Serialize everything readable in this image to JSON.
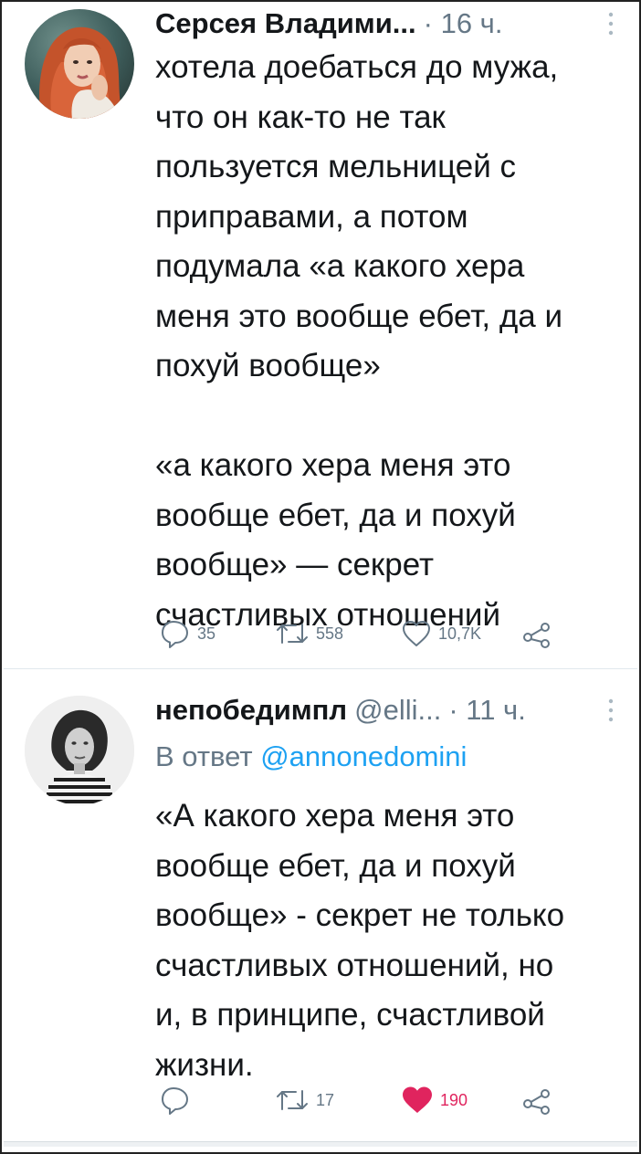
{
  "tweets": [
    {
      "author_name": "Серсея Владими...",
      "handle": "",
      "time": "· 16 ч.",
      "reply_prefix": "",
      "reply_handle": "",
      "text": "хотела доебаться до мужа,\nчто он как-то не так\nпользуется мельницей с\nприправами, а потом\nподумала «а какого хера\nменя это вообще ебет, да и\nпохуй вообще»\n\n«а какого хера меня это\nвообще ебет, да и похуй\nвообще» — секрет\nсчастливых отношений",
      "replies": "35",
      "retweets": "558",
      "likes": "10,7K",
      "liked": false
    },
    {
      "author_name": "непобедимпл",
      "handle": "@elli...",
      "time": "· 11 ч.",
      "reply_prefix": "В ответ",
      "reply_handle": "@annonedomini",
      "text": "«А какого хера меня это\nвообще ебет, да и похуй\nвообще» - секрет не только\nсчастливых отношений, но\nи, в принципе, счастливой\nжизни.",
      "replies": "",
      "retweets": "17",
      "likes": "190",
      "liked": true
    }
  ],
  "colors": {
    "text": "#14171a",
    "muted": "#657786",
    "link": "#1da1f2",
    "like": "#e0245e"
  },
  "icons": [
    "more-vertical-icon",
    "reply-icon",
    "retweet-icon",
    "like-icon",
    "share-icon"
  ]
}
